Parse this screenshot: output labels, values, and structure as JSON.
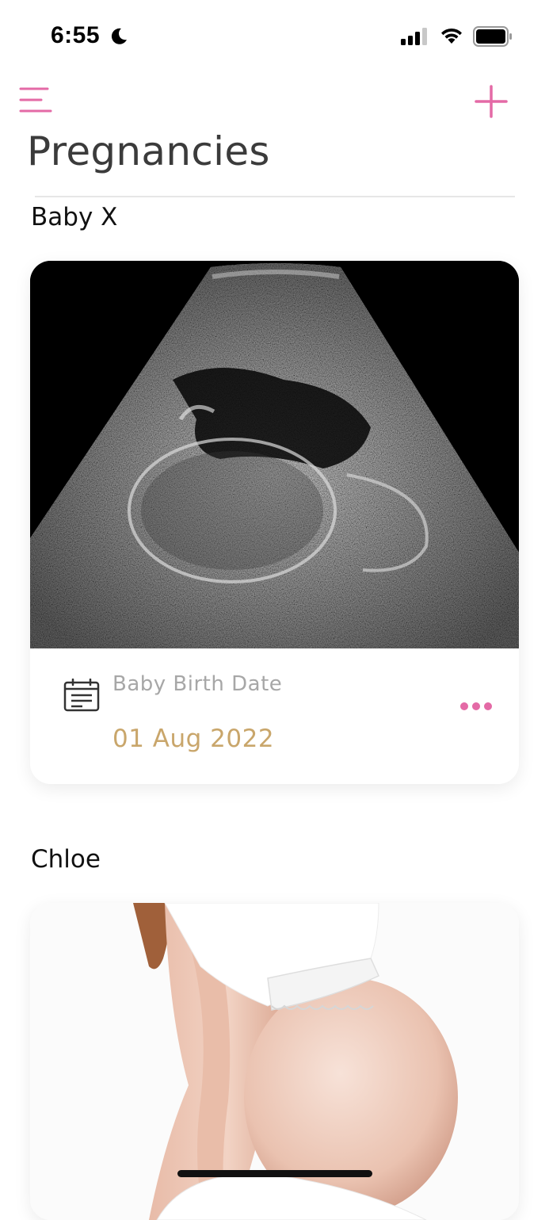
{
  "status_bar": {
    "time": "6:55",
    "icons": [
      "moon-icon",
      "cellular-signal-icon",
      "wifi-icon",
      "battery-icon"
    ]
  },
  "header": {
    "menu_icon": "hamburger-menu-icon",
    "add_icon": "plus-icon",
    "title": "Pregnancies"
  },
  "colors": {
    "accent": "#e46aa6",
    "date": "#c9a66b",
    "label": "#a7a7a7",
    "title": "#3b3b3b"
  },
  "pregnancies": [
    {
      "name": "Baby X",
      "image": "ultrasound-image",
      "birth_label": "Baby Birth Date",
      "birth_date": "01 Aug 2022",
      "more_icon": "more-horizontal-icon"
    },
    {
      "name": "Chloe",
      "image": "pregnant-belly-photo"
    }
  ]
}
